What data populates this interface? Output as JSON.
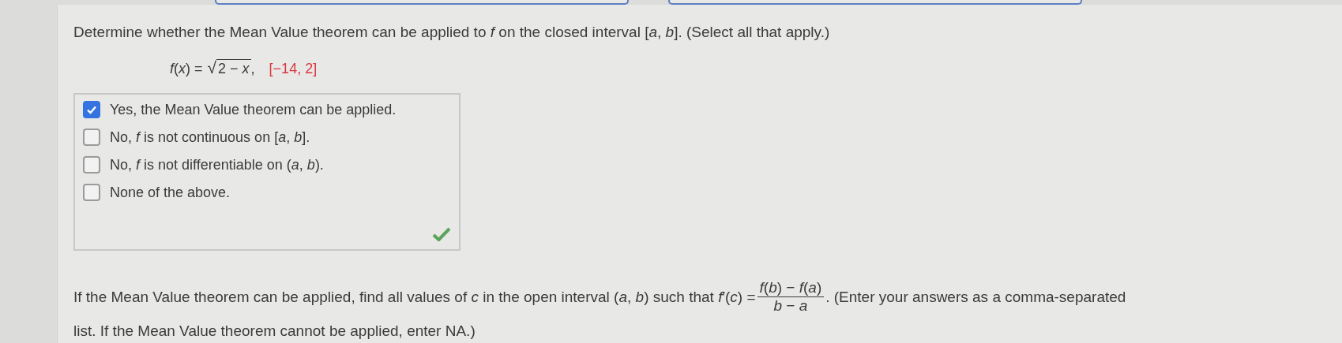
{
  "question": {
    "text": "Determine whether the Mean Value theorem can be applied to *f* on the closed interval [*a*, *b*]. (Select all that apply.)",
    "formula": {
      "lhs": "*f*(*x*) =",
      "radical_sign": "√",
      "radicand": "2 − *x*",
      "separator": ",",
      "interval": "[−14, 2]"
    }
  },
  "choices": [
    {
      "text": "Yes, the Mean Value theorem can be applied.",
      "checked": true
    },
    {
      "text": "No, *f* is not continuous on [*a*, *b*].",
      "checked": false
    },
    {
      "text": "No, *f* is not differentiable on (*a*, *b*).",
      "checked": false
    },
    {
      "text": "None of the above.",
      "checked": false
    }
  ],
  "answer_correct": true,
  "follow_up": {
    "before": "If the Mean Value theorem can be applied, find all values of *c* in the open interval (*a*, *b*) such that *f*′(*c*) =",
    "numerator": "*f*(*b*) − *f*(*a*)",
    "denominator": "*b* − *a*",
    "after": ". (Enter your answers as a comma-separated",
    "continuation": "list. If the Mean Value theorem cannot be applied, enter NA.)"
  }
}
